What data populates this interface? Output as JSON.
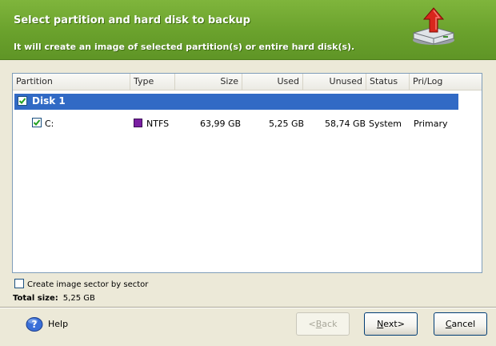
{
  "header": {
    "title": "Select partition and hard disk to backup",
    "subtitle": "It will create an image of selected partition(s) or entire hard disk(s)."
  },
  "list": {
    "columns": [
      "Partition",
      "Type",
      "Size",
      "Used",
      "Unused",
      "Status",
      "Pri/Log"
    ],
    "disk": {
      "label": "Disk 1",
      "checked": true
    },
    "partition": {
      "name": "C:",
      "type": "NTFS",
      "size": "63,99 GB",
      "used": "5,25 GB",
      "unused": "58,74 GB",
      "status": "System",
      "pri_log": "Primary",
      "checked": true
    }
  },
  "options": {
    "sector_by_sector_label": "Create image sector by sector",
    "sector_by_sector_checked": false
  },
  "total": {
    "label": "Total size:",
    "value": "5,25 GB"
  },
  "buttons": {
    "help": "Help",
    "back_mnemonic": "B",
    "back_rest": "ack",
    "back_prefix": "<",
    "next_mnemonic": "N",
    "next_rest": "ext>",
    "cancel_mnemonic": "C",
    "cancel_rest": "ancel"
  },
  "colors": {
    "header_green": "#6aa12c",
    "selection_blue": "#316ac5",
    "ntfs_swatch": "#7a1fa2"
  }
}
